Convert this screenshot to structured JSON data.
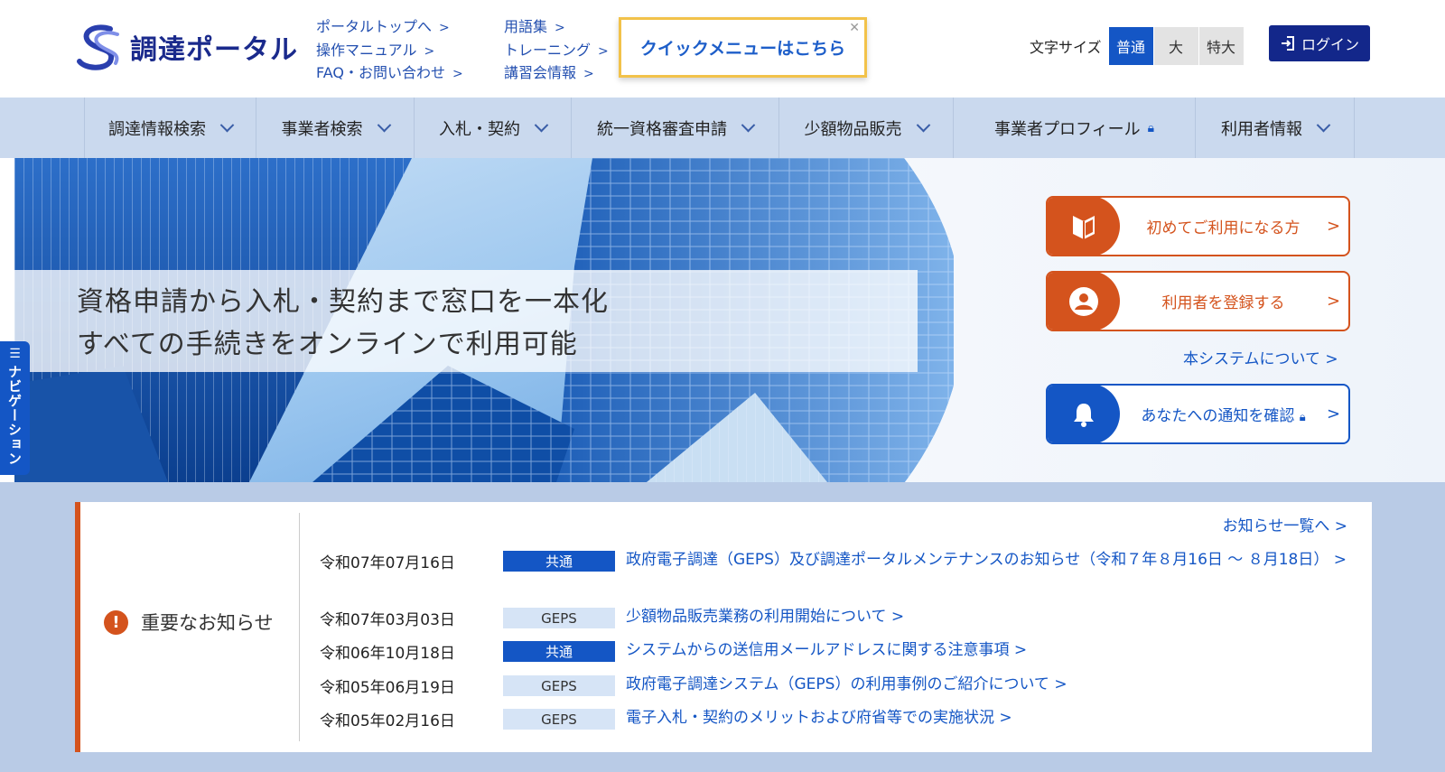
{
  "header": {
    "logo_text": "調達ポータル",
    "links_col1": [
      {
        "label": "ポータルトップへ"
      },
      {
        "label": "操作マニュアル"
      },
      {
        "label": "FAQ・お問い合わせ"
      }
    ],
    "links_col2": [
      {
        "label": "用語集"
      },
      {
        "label": "トレーニング"
      },
      {
        "label": "講習会情報"
      }
    ],
    "quick_menu": "クイックメニューはこちら",
    "font_size_label": "文字サイズ",
    "font_sizes": [
      "普通",
      "大",
      "特大"
    ],
    "font_size_selected": "普通",
    "login_label": "ログイン"
  },
  "nav": {
    "items": [
      {
        "label": "調達情報検索"
      },
      {
        "label": "事業者検索"
      },
      {
        "label": "入札・契約"
      },
      {
        "label": "統一資格審査申請"
      },
      {
        "label": "少額物品販売"
      },
      {
        "label": "事業者プロフィール"
      },
      {
        "label": "利用者情報"
      }
    ]
  },
  "hero": {
    "line1": "資格申請から入札・契約まで窓口を一本化",
    "line2": "すべての手続きをオンラインで利用可能",
    "first_time": "初めてご利用になる方",
    "register": "利用者を登録する",
    "about": "本システムについて",
    "notifications": "あなたへの通知を確認",
    "side_nav": "ナビゲーション"
  },
  "notices": {
    "heading": "重要なお知らせ",
    "all_link": "お知らせ一覧へ",
    "rows": [
      {
        "date": "令和07年07月16日",
        "tag": "共通",
        "title": "政府電子調達（GEPS）及び調達ポータルメンテナンスのお知らせ（令和７年８月16日 ～ ８月18日）"
      },
      {
        "date": "令和07年03月03日",
        "tag": "GEPS",
        "title": "少額物品販売業務の利用開始について"
      },
      {
        "date": "令和06年10月18日",
        "tag": "共通",
        "title": "システムからの送信用メールアドレスに関する注意事項"
      },
      {
        "date": "令和05年06月19日",
        "tag": "GEPS",
        "title": "政府電子調達システム（GEPS）の利用事例のご紹介について"
      },
      {
        "date": "令和05年02月16日",
        "tag": "GEPS",
        "title": "電子入札・契約のメリットおよび府省等での実施状況"
      }
    ]
  },
  "colors": {
    "brand_blue": "#1456c5",
    "navy": "#13278a",
    "accent_orange": "#d4531d",
    "nav_bg": "#cad9ee"
  }
}
